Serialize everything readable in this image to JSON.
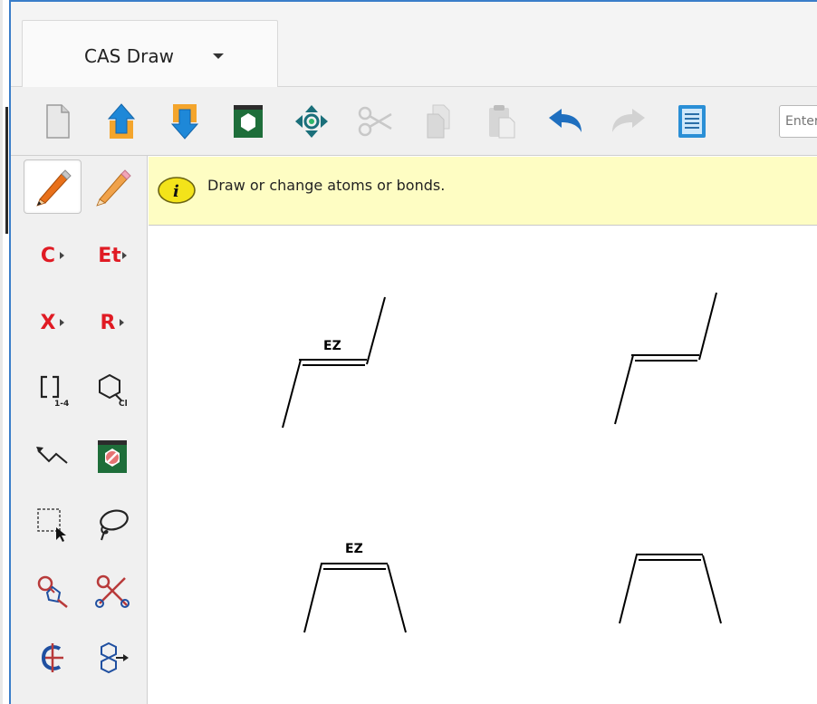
{
  "app": {
    "tab_title": "CAS Draw"
  },
  "toolbar": {
    "items": [
      {
        "name": "new-document",
        "icon": "document-icon"
      },
      {
        "name": "import",
        "icon": "upload-arrow-icon"
      },
      {
        "name": "export",
        "icon": "download-arrow-icon"
      },
      {
        "name": "template",
        "icon": "template-hexagon-icon"
      },
      {
        "name": "center",
        "icon": "center-target-icon"
      },
      {
        "name": "cut",
        "icon": "scissors-icon",
        "disabled": true
      },
      {
        "name": "copy",
        "icon": "copy-icon",
        "disabled": true
      },
      {
        "name": "paste",
        "icon": "paste-icon",
        "disabled": true
      },
      {
        "name": "undo",
        "icon": "undo-icon"
      },
      {
        "name": "redo",
        "icon": "redo-icon",
        "disabled": true
      },
      {
        "name": "document-list",
        "icon": "list-document-icon"
      }
    ],
    "search_placeholder": "Enter"
  },
  "palette": {
    "carbon_label": "C",
    "ethyl_label": "Et",
    "halogen_label": "X",
    "rgroup_label": "R",
    "bracket_sub": "1-4",
    "ring_sub": "Cl",
    "tools": [
      "draw-pencil-icon",
      "erase-pencil-icon",
      "bracket-icon",
      "ring-chain-icon",
      "chain-arrow-icon",
      "template-delete-icon",
      "rect-select-icon",
      "lasso-icon",
      "bond-attach-icon",
      "bond-cut-icon",
      "stereo-center-icon",
      "ring-rotate-icon"
    ]
  },
  "hint": {
    "text": "Draw or change atoms or bonds."
  },
  "canvas": {
    "structures": [
      {
        "kind": "trans-alkene",
        "label": "EZ"
      },
      {
        "kind": "trans-alkene",
        "label": ""
      },
      {
        "kind": "cis-alkene",
        "label": "EZ"
      },
      {
        "kind": "cis-alkene",
        "label": ""
      }
    ]
  },
  "colors": {
    "accent": "#3a7dc9",
    "hint_bg": "#fefdc3",
    "atom_red": "#e01b24"
  }
}
